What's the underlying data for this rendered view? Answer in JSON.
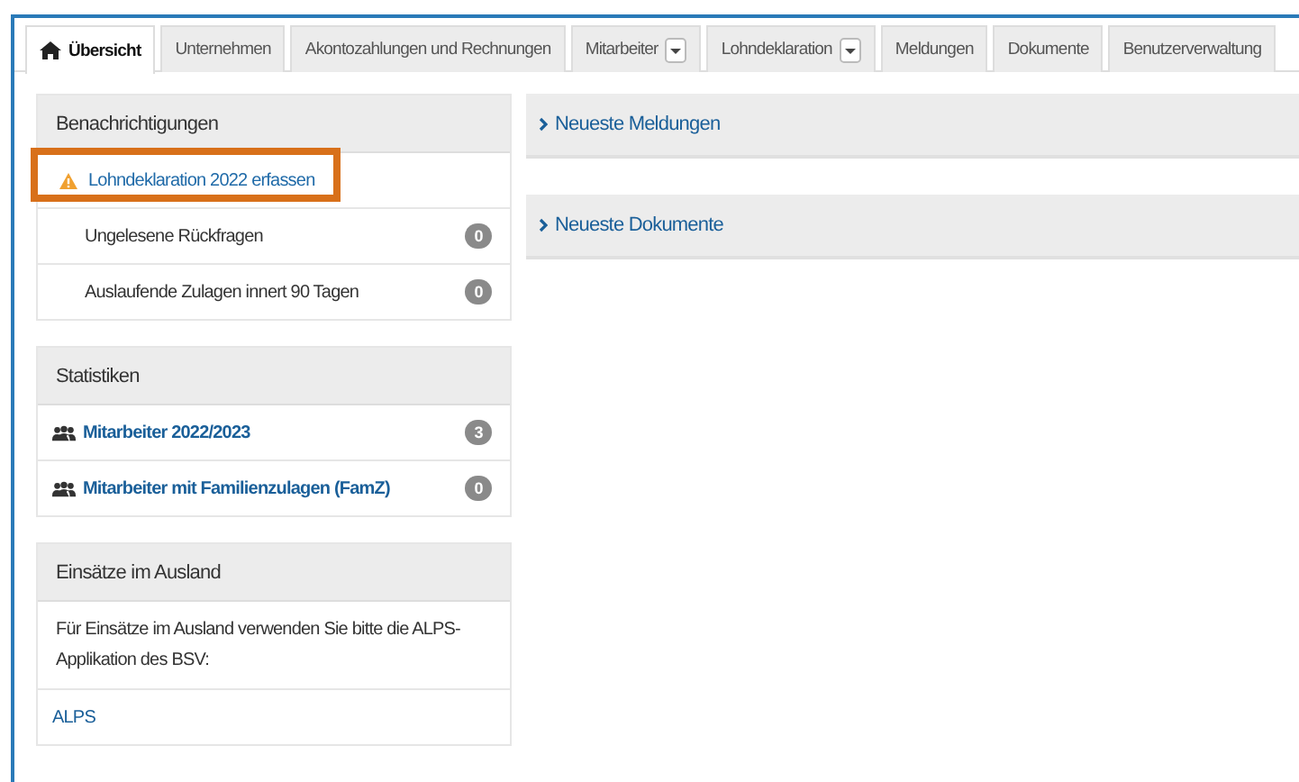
{
  "tabs": [
    {
      "label": "Übersicht",
      "selected": true,
      "icon": true,
      "dropdown": false
    },
    {
      "label": "Unternehmen",
      "selected": false,
      "icon": false,
      "dropdown": false
    },
    {
      "label": "Akontozahlungen und Rechnungen",
      "selected": false,
      "icon": false,
      "dropdown": false
    },
    {
      "label": "Mitarbeiter",
      "selected": false,
      "icon": false,
      "dropdown": true
    },
    {
      "label": "Lohndeklaration",
      "selected": false,
      "icon": false,
      "dropdown": true
    },
    {
      "label": "Meldungen",
      "selected": false,
      "icon": false,
      "dropdown": false
    },
    {
      "label": "Dokumente",
      "selected": false,
      "icon": false,
      "dropdown": false
    },
    {
      "label": "Benutzerverwaltung",
      "selected": false,
      "icon": false,
      "dropdown": false
    }
  ],
  "notifications": {
    "title": "Benachrichtigungen",
    "items": [
      {
        "kind": "warning",
        "label": "Lohndeklaration 2022 erfassen",
        "highlighted": true
      },
      {
        "kind": "count",
        "label": "Ungelesene Rückfragen",
        "count": "0"
      },
      {
        "kind": "count",
        "label": "Auslaufende Zulagen innert 90 Tagen",
        "count": "0"
      }
    ]
  },
  "statistics": {
    "title": "Statistiken",
    "items": [
      {
        "label": "Mitarbeiter 2022/2023",
        "count": "3"
      },
      {
        "label": "Mitarbeiter mit Familienzulagen (FamZ)",
        "count": "0"
      }
    ]
  },
  "abroad": {
    "title": "Einsätze im Ausland",
    "text": "Für Einsätze im Ausland verwenden Sie bitte die ALPS-Applikation des BSV:",
    "link": "ALPS"
  },
  "panels": [
    {
      "title": "Neueste Meldungen",
      "expanded": false
    },
    {
      "title": "Neueste Dokumente",
      "expanded": false
    }
  ]
}
